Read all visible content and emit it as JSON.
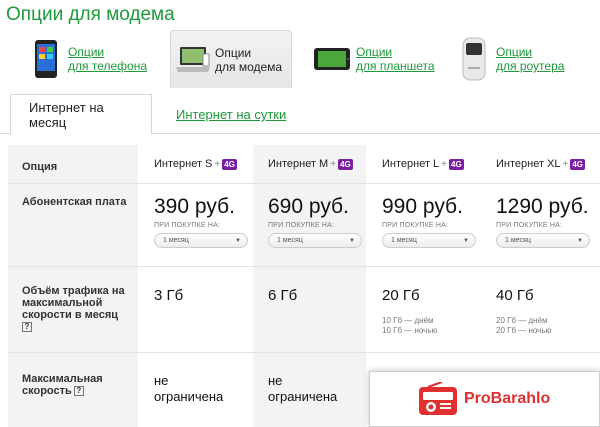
{
  "page_title": "Опции для модема",
  "device_tabs": [
    {
      "label_line1": "Опции",
      "label_line2": "для телефона",
      "icon": "phone-icon",
      "active": false
    },
    {
      "label_line1": "Опции",
      "label_line2": "для модема",
      "icon": "laptop-modem-icon",
      "active": true
    },
    {
      "label_line1": "Опции",
      "label_line2": "для планшета",
      "icon": "tablet-icon",
      "active": false
    },
    {
      "label_line1": "Опции",
      "label_line2": "для роутера",
      "icon": "router-icon",
      "active": false
    }
  ],
  "sub_tabs": [
    {
      "label": "Интернет на месяц",
      "active": true
    },
    {
      "label": "Интернет на сутки",
      "active": false
    }
  ],
  "table": {
    "header_label": "Опция",
    "badge": "4G",
    "plus": "+",
    "plans": [
      {
        "name": "Интернет S",
        "price": "390 руб.",
        "purchase_label": "ПРИ ПОКУПКЕ НА:",
        "period": "1 месяц",
        "traffic": "3 Гб",
        "traffic_note_day": "",
        "traffic_note_night": "",
        "speed_line1": "не",
        "speed_line2": "ограничена"
      },
      {
        "name": "Интернет M",
        "price": "690 руб.",
        "purchase_label": "ПРИ ПОКУПКЕ НА:",
        "period": "1 месяц",
        "traffic": "6 Гб",
        "traffic_note_day": "",
        "traffic_note_night": "",
        "speed_line1": "не",
        "speed_line2": "ограничена"
      },
      {
        "name": "Интернет L",
        "price": "990 руб.",
        "purchase_label": "ПРИ ПОКУПКЕ НА:",
        "period": "1 месяц",
        "traffic": "20 Гб",
        "traffic_note_day": "10 Гб — днём",
        "traffic_note_night": "10 Гб — ночью",
        "speed_line1": "",
        "speed_line2": ""
      },
      {
        "name": "Интернет XL",
        "price": "1290 руб.",
        "purchase_label": "ПРИ ПОКУПКЕ НА:",
        "period": "1 месяц",
        "traffic": "40 Гб",
        "traffic_note_day": "20 Гб — днём",
        "traffic_note_night": "20 Гб — ночью",
        "speed_line1": "",
        "speed_line2": ""
      }
    ],
    "rows": {
      "fee": "Абонентская плата",
      "traffic_line1": "Объём трафика на",
      "traffic_line2": "максимальной",
      "traffic_line3": "скорости в месяц",
      "speed_line1": "Максимальная",
      "speed_line2": "скорость"
    },
    "help_mark": "?"
  },
  "watermark": {
    "text": "ProBarahlo",
    "icon": "radio-icon"
  },
  "colors": {
    "accent_green": "#1d9a3a",
    "badge_purple": "#7a1fa2",
    "watermark_red": "#e03030"
  }
}
